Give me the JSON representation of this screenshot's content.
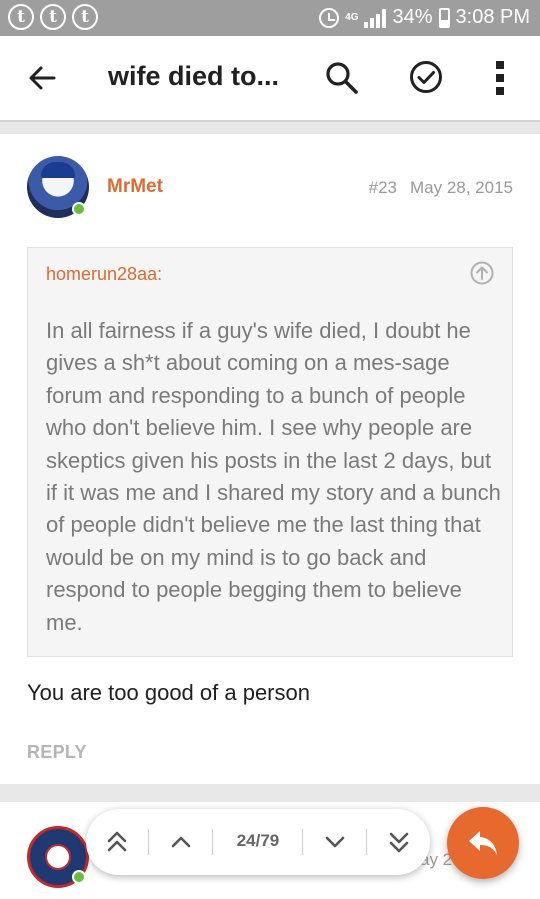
{
  "status_bar": {
    "notification_icons": [
      "t",
      "t",
      "t"
    ],
    "network": "4G",
    "battery": "34%",
    "time": "3:08 PM",
    "battery_level": 0.34
  },
  "app_bar": {
    "title": "wife died to..."
  },
  "post": {
    "username": "MrMet",
    "post_number": "#23",
    "date": "May 28, 2015",
    "quote": {
      "author": "homerun28aa:",
      "text": "In all fairness if a guy's wife died, I doubt he gives a sh*t about coming on a mes-sage forum and responding to a bunch of people who don't believe him. I see why people are skeptics given his posts in the last 2 days, but if it was me and I shared my story and a bunch of people didn't believe me the last thing that would be on my mind is to go back and respond to people begging them to believe me."
    },
    "body": "You are too good of a person",
    "reply_label": "REPLY"
  },
  "next_post": {
    "date_peek": "ay 2"
  },
  "pager": {
    "current_page": "24/79"
  },
  "colors": {
    "accent": "#e8692e",
    "username": "#e06a2f",
    "online": "#6abf3a"
  }
}
